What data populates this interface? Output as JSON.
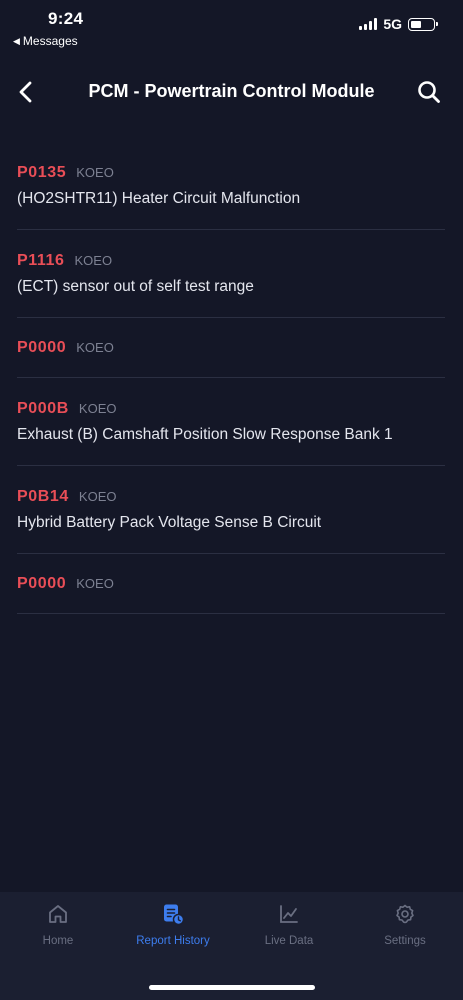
{
  "status_bar": {
    "time": "9:24",
    "back_app": "Messages",
    "network": "5G"
  },
  "header": {
    "title": "PCM - Powertrain Control Module",
    "back_icon": "chevron-left-icon",
    "search_icon": "search-icon"
  },
  "dtcs": [
    {
      "code": "P0135",
      "tag": "KOEO",
      "description": "(HO2SHTR11) Heater Circuit Malfunction"
    },
    {
      "code": "P1116",
      "tag": "KOEO",
      "description": "(ECT) sensor out of self test range"
    },
    {
      "code": "P0000",
      "tag": "KOEO",
      "description": ""
    },
    {
      "code": "P000B",
      "tag": "KOEO",
      "description": "Exhaust (B) Camshaft Position Slow Response Bank 1"
    },
    {
      "code": "P0B14",
      "tag": "KOEO",
      "description": "Hybrid Battery Pack Voltage Sense B Circuit"
    },
    {
      "code": "P0000",
      "tag": "KOEO",
      "description": ""
    }
  ],
  "tabs": [
    {
      "label": "Home",
      "icon": "home-icon",
      "active": false
    },
    {
      "label": "Report History",
      "icon": "report-history-icon",
      "active": true
    },
    {
      "label": "Live Data",
      "icon": "chart-line-icon",
      "active": false
    },
    {
      "label": "Settings",
      "icon": "gear-icon",
      "active": false
    }
  ],
  "colors": {
    "background": "#141727",
    "code_red": "#e94e57",
    "tag_gray": "#7d8192",
    "active_tab": "#3d7dee",
    "inactive_tab": "#6a6f82"
  }
}
